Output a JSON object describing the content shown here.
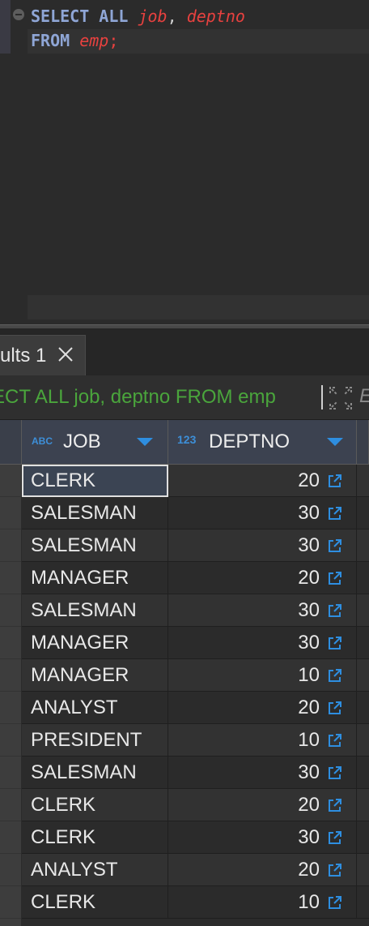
{
  "editor": {
    "line1": {
      "kw1": "SELECT",
      "kw2": "ALL",
      "col1": "job",
      "comma": ",",
      "col2": "deptno"
    },
    "line2": {
      "kw1": "FROM",
      "table": "emp",
      "semi": ";"
    }
  },
  "results": {
    "tab_label": "ults 1",
    "filter_text": "ECT ALL job, deptno FROM emp",
    "filter_extra": "E"
  },
  "grid": {
    "columns": [
      {
        "type_icon": "ABC",
        "label": "JOB"
      },
      {
        "type_icon": "123",
        "label": "DEPTNO"
      }
    ],
    "rows": [
      {
        "job": "CLERK",
        "deptno": "20"
      },
      {
        "job": "SALESMAN",
        "deptno": "30"
      },
      {
        "job": "SALESMAN",
        "deptno": "30"
      },
      {
        "job": "MANAGER",
        "deptno": "20"
      },
      {
        "job": "SALESMAN",
        "deptno": "30"
      },
      {
        "job": "MANAGER",
        "deptno": "30"
      },
      {
        "job": "MANAGER",
        "deptno": "10"
      },
      {
        "job": "ANALYST",
        "deptno": "20"
      },
      {
        "job": "PRESIDENT",
        "deptno": "10"
      },
      {
        "job": "SALESMAN",
        "deptno": "30"
      },
      {
        "job": "CLERK",
        "deptno": "20"
      },
      {
        "job": "CLERK",
        "deptno": "30"
      },
      {
        "job": "ANALYST",
        "deptno": "20"
      },
      {
        "job": "CLERK",
        "deptno": "10"
      }
    ]
  },
  "colors": {
    "keyword": "#8fa6d6",
    "identifier": "#e8413f",
    "filter_text": "#4aa53c",
    "accent": "#2e8ee0"
  },
  "icons": {
    "fold": "collapse-icon",
    "tab_close": "close-icon",
    "panel_expand": "expand-icon",
    "sort": "chevron-down-icon",
    "cell_link": "external-link-icon"
  }
}
